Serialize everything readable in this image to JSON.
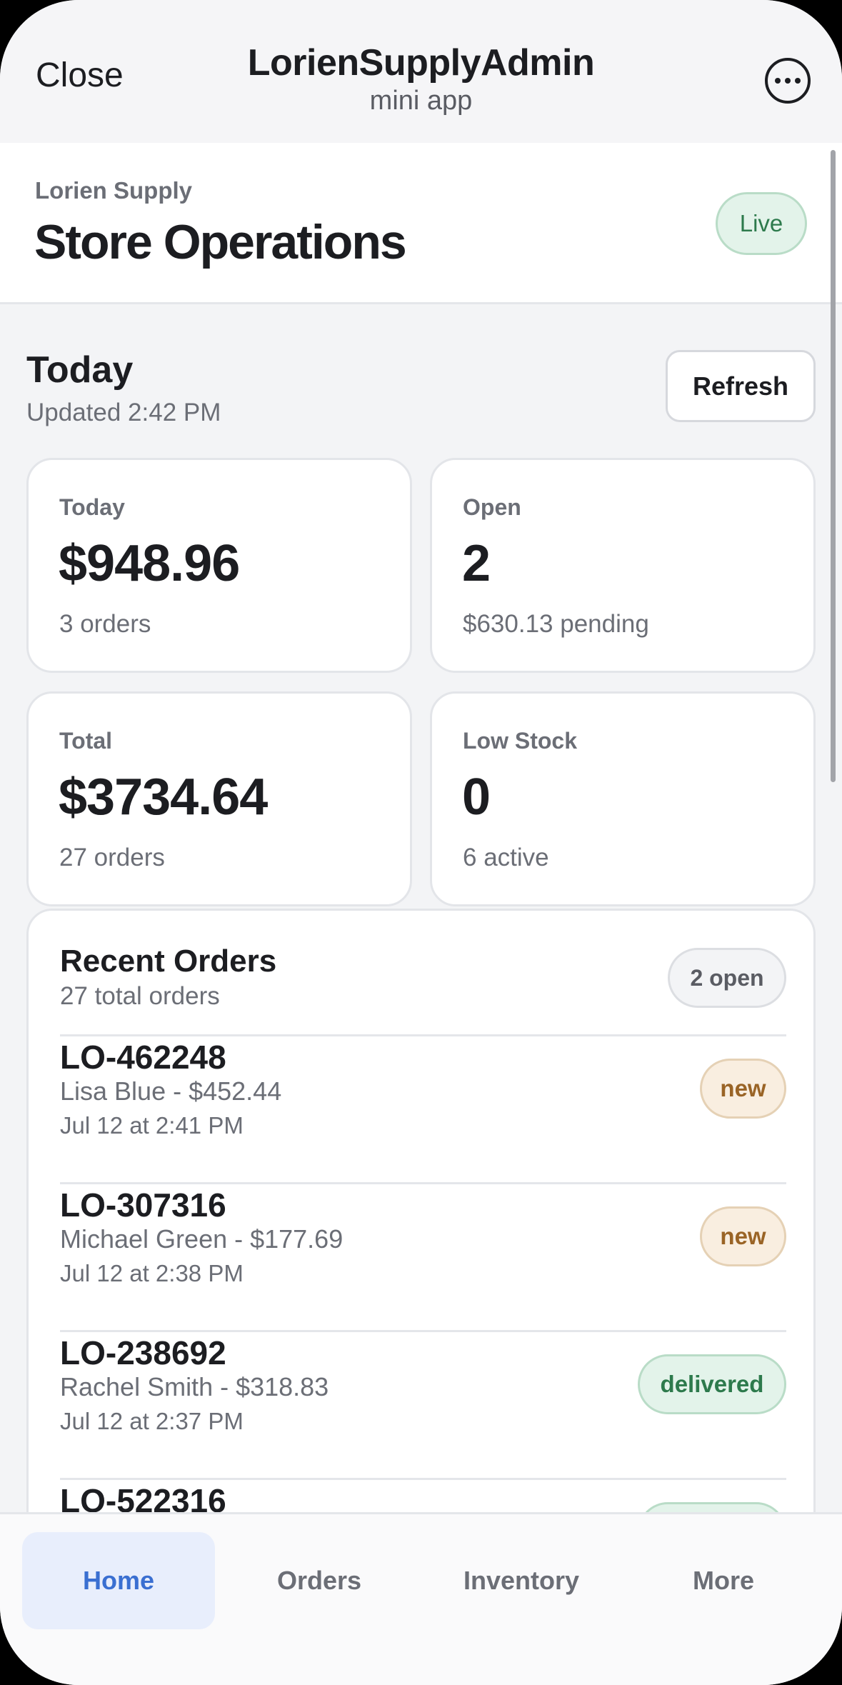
{
  "topbar": {
    "close_label": "Close",
    "title": "LorienSupplyAdmin",
    "subtitle": "mini app",
    "more_icon": "ellipsis-circle-icon"
  },
  "store": {
    "eyebrow": "Lorien Supply",
    "title": "Store Operations",
    "status_badge": "Live"
  },
  "today": {
    "title": "Today",
    "updated": "Updated 2:42 PM",
    "refresh_label": "Refresh"
  },
  "stats": [
    {
      "label": "Today",
      "value": "$948.96",
      "sub": "3 orders"
    },
    {
      "label": "Open",
      "value": "2",
      "sub": "$630.13 pending"
    },
    {
      "label": "Total",
      "value": "$3734.64",
      "sub": "27 orders"
    },
    {
      "label": "Low Stock",
      "value": "0",
      "sub": "6 active"
    }
  ],
  "recent_orders": {
    "title": "Recent Orders",
    "subtitle": "27 total orders",
    "open_pill": "2 open",
    "orders": [
      {
        "id": "LO-462248",
        "who": "Lisa Blue - $452.44",
        "date": "Jul 12 at 2:41 PM",
        "status": "new"
      },
      {
        "id": "LO-307316",
        "who": "Michael Green - $177.69",
        "date": "Jul 12 at 2:38 PM",
        "status": "new"
      },
      {
        "id": "LO-238692",
        "who": "Rachel Smith - $318.83",
        "date": "Jul 12 at 2:37 PM",
        "status": "delivered"
      },
      {
        "id": "LO-522316",
        "who": "",
        "date": "",
        "status": ""
      }
    ]
  },
  "tabs": [
    {
      "label": "Home",
      "active": true
    },
    {
      "label": "Orders",
      "active": false
    },
    {
      "label": "Inventory",
      "active": false
    },
    {
      "label": "More",
      "active": false
    }
  ],
  "colors": {
    "accent": "#3a6fd1",
    "success": "#2d7a4c",
    "warning": "#9a6426",
    "background": "#f3f4f6"
  }
}
